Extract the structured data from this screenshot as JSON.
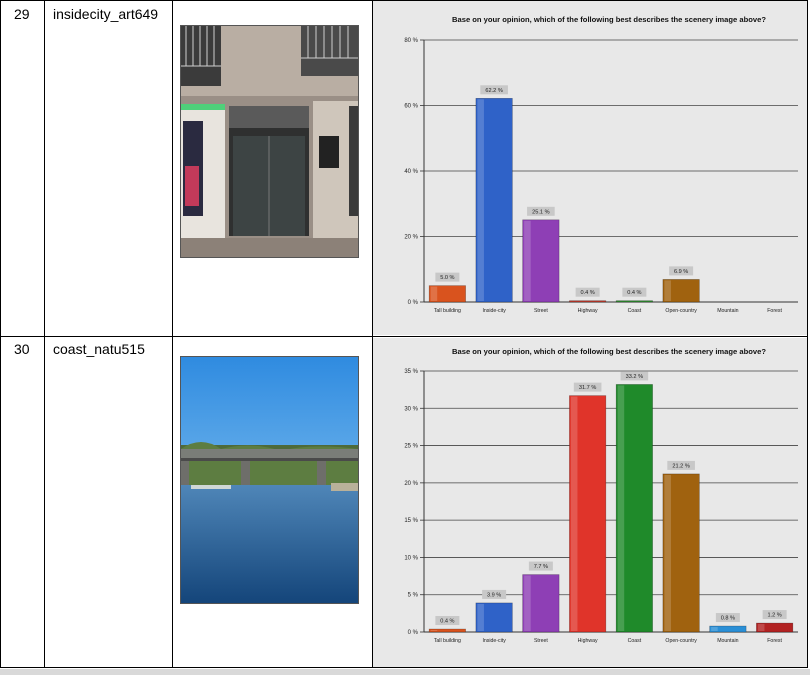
{
  "rows": [
    {
      "number": "29",
      "name": "insidecity_art649",
      "photo_icon": "city-storefront-photo"
    },
    {
      "number": "30",
      "name": "coast_natu515",
      "photo_icon": "river-bridge-photo"
    }
  ],
  "chart_data": [
    {
      "type": "bar",
      "title": "Base on your opinion, which of the following best describes the scenery image above?",
      "categories": [
        "Tall building",
        "Inside-city",
        "Street",
        "Highway",
        "Coast",
        "Open-country",
        "Mountain",
        "Forest"
      ],
      "values": [
        5.0,
        62.2,
        25.1,
        0.4,
        0.4,
        6.9,
        null,
        null
      ],
      "value_labels": [
        "5.0 %",
        "62.2 %",
        "25.1 %",
        "0.4 %",
        "0.4 %",
        "6.9 %",
        "",
        ""
      ],
      "ylim": [
        0,
        80
      ],
      "yticks": [
        0,
        20,
        40,
        60,
        80
      ],
      "ytick_labels": [
        "0 %",
        "20 %",
        "40 %",
        "60 %",
        "80 %"
      ],
      "colors": [
        "#d9531e",
        "#2f62c8",
        "#8e3fb5",
        "#c0392b",
        "#2e8b2e",
        "#a0620f",
        "#2a8fd6",
        "#b22222"
      ],
      "grid": true
    },
    {
      "type": "bar",
      "title": "Base on your opinion, which of the following best describes the scenery image above?",
      "categories": [
        "Tall building",
        "Inside-city",
        "Street",
        "Highway",
        "Coast",
        "Open-country",
        "Mountain",
        "Forest"
      ],
      "values": [
        0.4,
        3.9,
        7.7,
        31.7,
        33.2,
        21.2,
        0.8,
        1.2
      ],
      "value_labels": [
        "0.4 %",
        "3.9 %",
        "7.7 %",
        "31.7 %",
        "33.2 %",
        "21.2 %",
        "0.8 %",
        "1.2 %"
      ],
      "ylim": [
        0,
        35
      ],
      "yticks": [
        0,
        5,
        10,
        15,
        20,
        25,
        30,
        35
      ],
      "ytick_labels": [
        "0 %",
        "5 %",
        "10 %",
        "15 %",
        "20 %",
        "25 %",
        "30 %",
        "35 %"
      ],
      "colors": [
        "#d9531e",
        "#2f62c8",
        "#8e3fb5",
        "#e0342a",
        "#1f8a2a",
        "#a0620f",
        "#2a8fd6",
        "#b22222"
      ],
      "grid": true
    }
  ]
}
